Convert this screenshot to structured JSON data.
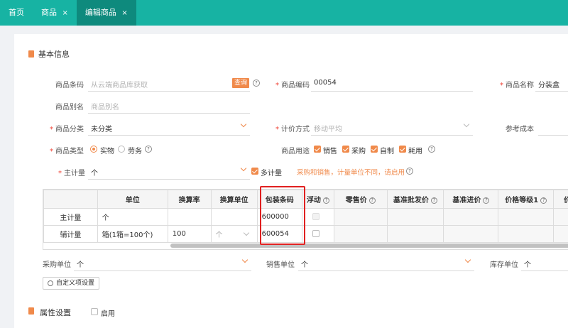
{
  "tabs": [
    {
      "label": "首页",
      "closable": false
    },
    {
      "label": "商品",
      "closable": true
    },
    {
      "label": "编辑商品",
      "closable": true,
      "active": true
    }
  ],
  "close_glyph": "×",
  "basic_info": {
    "title": "基本信息",
    "fields": {
      "barcode": {
        "label": "商品条码",
        "placeholder": "从云端商品库获取",
        "query_button": "查询"
      },
      "code": {
        "label": "商品编码",
        "value": "00054"
      },
      "name": {
        "label": "商品名称",
        "value": "分装盒"
      },
      "alias": {
        "label": "商品别名",
        "placeholder": "商品别名"
      },
      "category": {
        "label": "商品分类",
        "value": "未分类"
      },
      "valuation": {
        "label": "计价方式",
        "value": "移动平均"
      },
      "ref_cost": {
        "label": "参考成本"
      },
      "type": {
        "label": "商品类型",
        "options": [
          "实物",
          "劳务"
        ],
        "selected": "实物"
      },
      "usage": {
        "label": "商品用途",
        "options": [
          "销售",
          "采购",
          "自制",
          "耗用"
        ]
      },
      "main_unit": {
        "label": "主计量",
        "value": "个"
      },
      "multi_unit": {
        "label": "多计量",
        "checked": true,
        "hint": "采购和销售，计量单位不同，请启用"
      }
    }
  },
  "units_table": {
    "headers": [
      "",
      "单位",
      "换算率",
      "换算单位",
      "包装条码",
      "浮动",
      "零售价",
      "基准批发价",
      "基准进价",
      "价格等级1",
      "价"
    ],
    "rows": [
      {
        "role": "主计量",
        "unit": "个",
        "rate": "",
        "conv_unit": "",
        "barcode": "600000"
      },
      {
        "role": "辅计量",
        "unit": "箱(1箱=100个)",
        "rate": "100",
        "conv_unit": "个",
        "barcode": "600054"
      }
    ]
  },
  "units_bottom": {
    "purchase": {
      "label": "采购单位",
      "value": "个"
    },
    "sale": {
      "label": "销售单位",
      "value": "个"
    },
    "stock": {
      "label": "库存单位",
      "value": "个"
    },
    "custom_button": "自定义项设置"
  },
  "attributes": {
    "title": "属性设置",
    "enable_label": "启用"
  },
  "colors": {
    "accent": "#f08a4b",
    "tabbar": "#17b3a3",
    "tab_active": "#0e8a7d",
    "required": "#f04134",
    "highlight_box": "#e02020"
  }
}
